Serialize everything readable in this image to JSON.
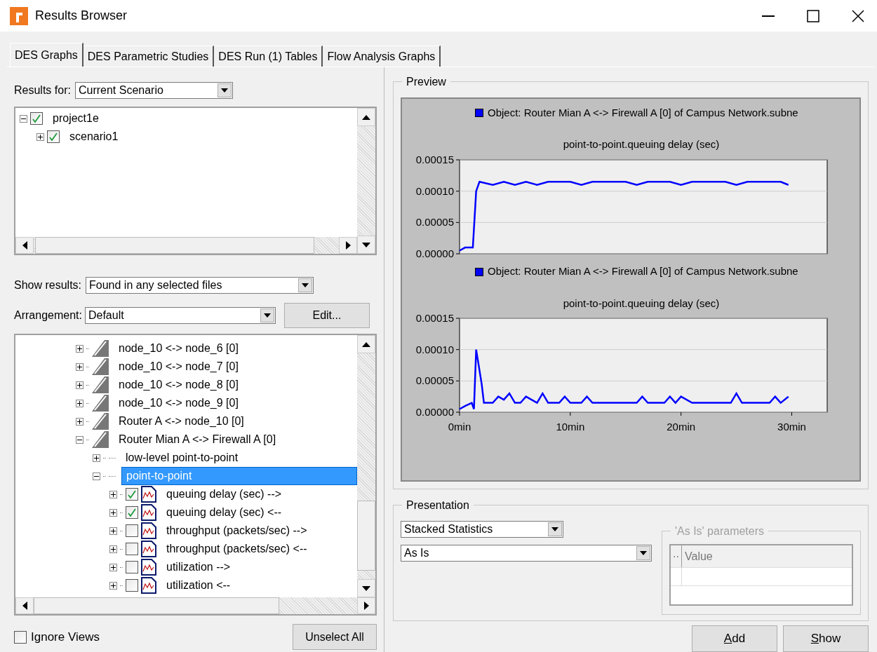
{
  "window": {
    "title": "Results Browser"
  },
  "tabs": [
    {
      "label": "DES Graphs",
      "selected": true
    },
    {
      "label": "DES Parametric Studies",
      "selected": false
    },
    {
      "label": "DES Run (1) Tables",
      "selected": false
    },
    {
      "label": "Flow Analysis Graphs",
      "selected": false
    }
  ],
  "results_for": {
    "label": "Results for:",
    "value": "Current Scenario"
  },
  "scenario_tree": [
    {
      "label": "project1e",
      "checked": true,
      "expanded": true,
      "children": [
        {
          "label": "scenario1",
          "checked": true,
          "expanded": false
        }
      ]
    }
  ],
  "show_results": {
    "label": "Show results:",
    "value": "Found in any selected files"
  },
  "arrangement": {
    "label": "Arrangement:",
    "value": "Default",
    "button": "Edit..."
  },
  "statistics_tree": [
    {
      "kind": "link",
      "label": "node_10 <-> node_6 [0]",
      "expanded": false,
      "selected": false
    },
    {
      "kind": "link",
      "label": "node_10 <-> node_7 [0]",
      "expanded": false,
      "selected": false
    },
    {
      "kind": "link",
      "label": "node_10 <-> node_8 [0]",
      "expanded": false,
      "selected": false
    },
    {
      "kind": "link",
      "label": "node_10 <-> node_9 [0]",
      "expanded": false,
      "selected": false
    },
    {
      "kind": "link",
      "label": "Router A <-> node_10 [0]",
      "expanded": false,
      "selected": false
    },
    {
      "kind": "link",
      "label": "Router Mian A <-> Firewall A [0]",
      "expanded": true,
      "selected": false,
      "children": [
        {
          "kind": "group",
          "label": "low-level point-to-point",
          "expanded": false,
          "selected": false
        },
        {
          "kind": "group",
          "label": "point-to-point",
          "expanded": true,
          "selected": true,
          "children": [
            {
              "kind": "statistic",
              "label": "queuing delay (sec) -->",
              "expanded": false,
              "selected": false,
              "checked": true
            },
            {
              "kind": "statistic",
              "label": "queuing delay (sec) <--",
              "expanded": false,
              "selected": false,
              "checked": true
            },
            {
              "kind": "statistic",
              "label": "throughput (packets/sec) -->",
              "expanded": false,
              "selected": false,
              "checked": false
            },
            {
              "kind": "statistic",
              "label": "throughput (packets/sec) <--",
              "expanded": false,
              "selected": false,
              "checked": false
            },
            {
              "kind": "statistic",
              "label": "utilization -->",
              "expanded": false,
              "selected": false,
              "checked": false
            },
            {
              "kind": "statistic",
              "label": "utilization <--",
              "expanded": false,
              "selected": false,
              "checked": false
            }
          ]
        }
      ]
    }
  ],
  "ignore_views": {
    "label": "Ignore Views",
    "checked": false
  },
  "unselect_all": "Unselect All",
  "preview": {
    "title": "Preview",
    "panels": [
      {
        "chart_data": {
          "type": "line",
          "title": "point-to-point.queuing delay (sec)",
          "xlim": [
            0,
            33.2
          ],
          "ylim": [
            0,
            0.00015
          ],
          "yticks": [
            {
              "value": 0,
              "label": "0.00000"
            },
            {
              "value": 5e-05,
              "label": "0.00005"
            },
            {
              "value": 0.0001,
              "label": "0.00010"
            },
            {
              "value": 0.00015,
              "label": "0.00015"
            }
          ],
          "x": [
            0,
            0.5,
            1.2,
            1.5,
            1.8,
            3,
            4,
            5,
            6,
            7,
            8,
            9,
            10,
            11,
            12,
            13,
            14,
            15,
            16,
            17,
            18,
            19,
            20,
            21,
            22,
            23,
            24,
            25,
            26,
            27,
            28,
            29,
            29.7
          ],
          "series": [
            {
              "name": "Object: Router Mian A <-> Firewall A [0] of Campus Network.subne",
              "color": "#0000ff",
              "values": [
                5e-06,
                1e-05,
                1e-05,
                0.0001,
                0.000115,
                0.00011,
                0.000115,
                0.00011,
                0.000115,
                0.00011,
                0.000115,
                0.000115,
                0.000115,
                0.00011,
                0.000115,
                0.000115,
                0.000115,
                0.000115,
                0.00011,
                0.000115,
                0.000115,
                0.000115,
                0.00011,
                0.000115,
                0.000115,
                0.000115,
                0.000115,
                0.00011,
                0.000115,
                0.000115,
                0.000115,
                0.000115,
                0.00011
              ]
            }
          ]
        }
      },
      {
        "chart_data": {
          "type": "line",
          "title": "point-to-point.queuing delay (sec)",
          "xlim": [
            0,
            33.2
          ],
          "ylim": [
            0,
            0.00015
          ],
          "yticks": [
            {
              "value": 0,
              "label": "0.00000"
            },
            {
              "value": 5e-05,
              "label": "0.00005"
            },
            {
              "value": 0.0001,
              "label": "0.00010"
            },
            {
              "value": 0.00015,
              "label": "0.00015"
            }
          ],
          "xticks": [
            {
              "value": 0,
              "label": "0min"
            },
            {
              "value": 10,
              "label": "10min"
            },
            {
              "value": 20,
              "label": "20min"
            },
            {
              "value": 30,
              "label": "30min"
            }
          ],
          "x": [
            0,
            0.5,
            1.1,
            1.3,
            1.5,
            2,
            2.2,
            3,
            3.5,
            4,
            4.5,
            5,
            5.5,
            6,
            7,
            7.5,
            8,
            9,
            9.5,
            10,
            11,
            11.5,
            12,
            16,
            16.5,
            17,
            18.5,
            19,
            19.5,
            20,
            21,
            24.5,
            25,
            25.5,
            28,
            28.5,
            29,
            29.7
          ],
          "series": [
            {
              "name": "Object: Router Mian A <-> Firewall A [0] of Campus Network.subne",
              "color": "#0000ff",
              "values": [
                5e-06,
                1e-05,
                1.5e-05,
                5e-06,
                0.0001,
                4.5e-05,
                1.5e-05,
                1.5e-05,
                2.5e-05,
                2e-05,
                3e-05,
                1.5e-05,
                1.5e-05,
                2.5e-05,
                1.5e-05,
                3e-05,
                1.5e-05,
                1.5e-05,
                2.5e-05,
                1.5e-05,
                1.5e-05,
                2.5e-05,
                1.5e-05,
                1.5e-05,
                2.5e-05,
                1.5e-05,
                1.5e-05,
                2.5e-05,
                1.5e-05,
                2.5e-05,
                1.5e-05,
                1.5e-05,
                3e-05,
                1.5e-05,
                1.5e-05,
                2.5e-05,
                1.5e-05,
                2.5e-05
              ]
            }
          ]
        }
      }
    ]
  },
  "presentation": {
    "title": "Presentation",
    "mode": "Stacked Statistics",
    "filter": "As Is",
    "parameters": {
      "title": "'As Is' parameters",
      "columns": [
        "..",
        "Value"
      ]
    }
  },
  "buttons": [
    {
      "label": "Add"
    },
    {
      "label": "Show"
    }
  ]
}
